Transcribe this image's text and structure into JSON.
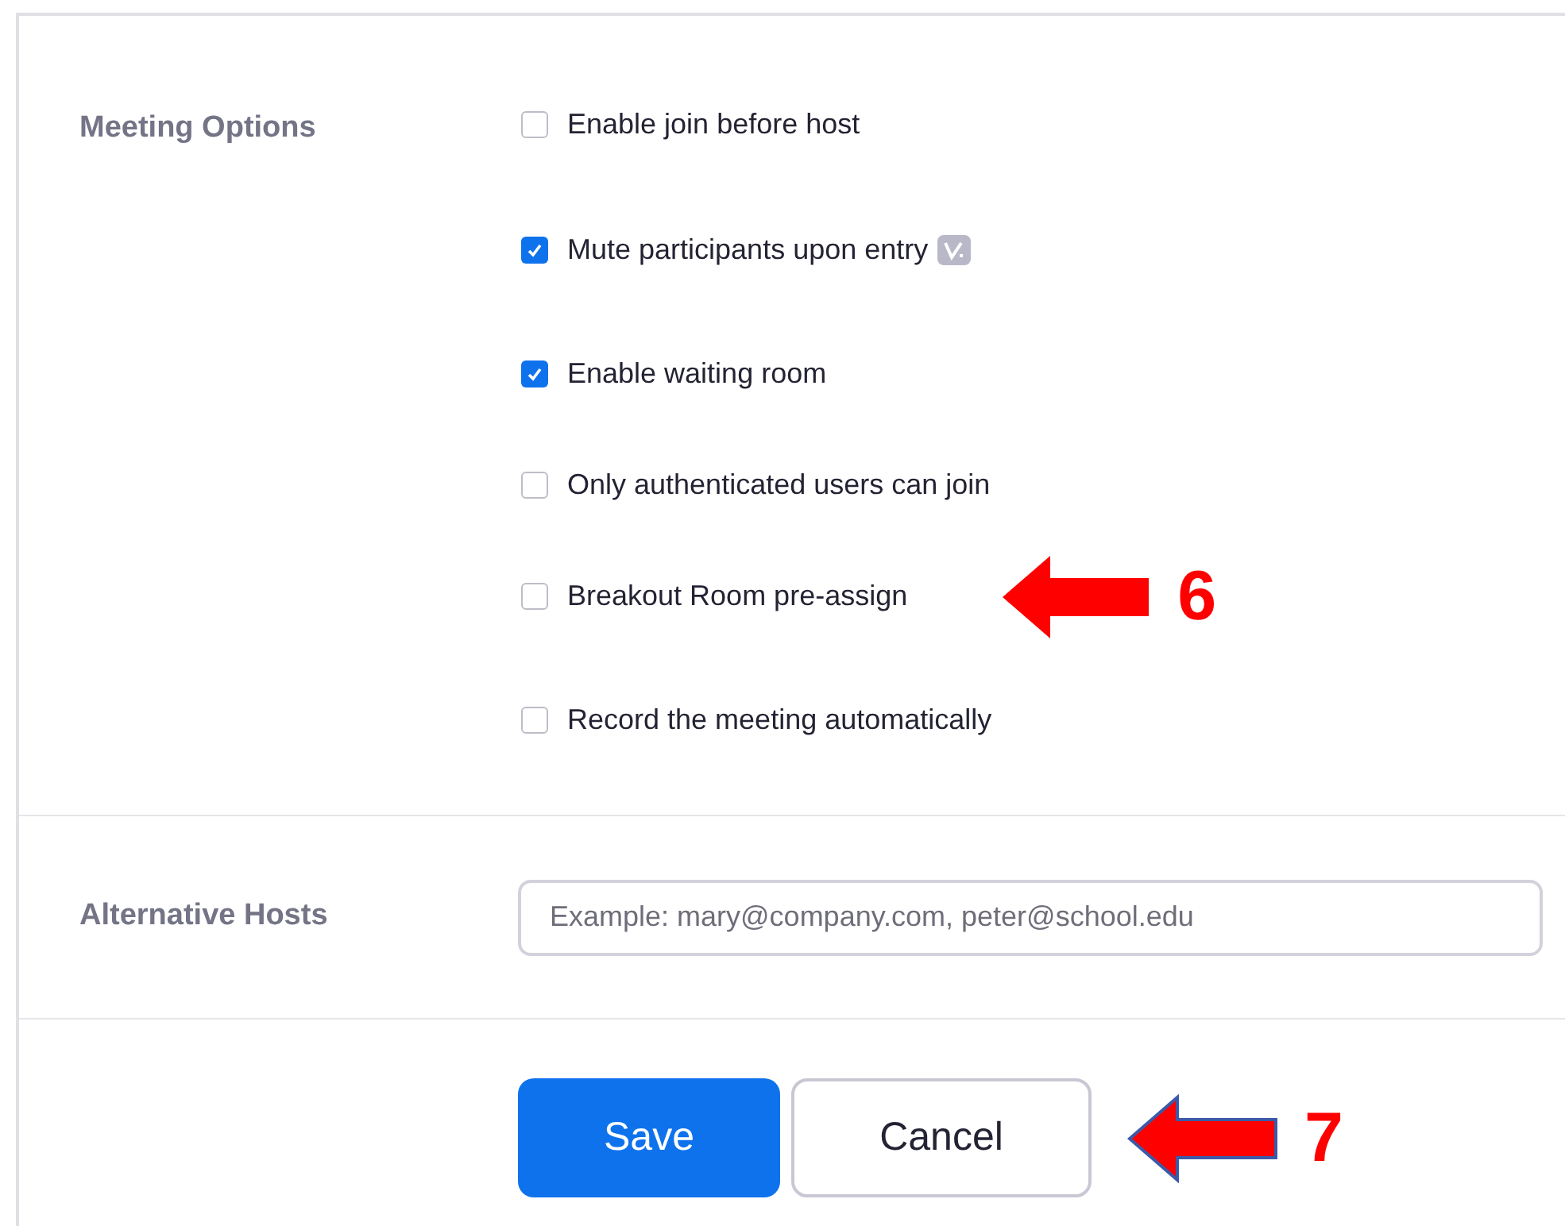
{
  "meeting_options": {
    "label": "Meeting Options",
    "options": [
      {
        "label": "Enable join before host",
        "checked": false
      },
      {
        "label": "Mute participants upon entry",
        "checked": true,
        "badge": true
      },
      {
        "label": "Enable waiting room",
        "checked": true
      },
      {
        "label": "Only authenticated users can join",
        "checked": false
      },
      {
        "label": "Breakout Room pre-assign",
        "checked": false,
        "annotation": {
          "number": "6",
          "outlined": false
        }
      },
      {
        "label": "Record the meeting automatically",
        "checked": false
      }
    ]
  },
  "alternative_hosts": {
    "label": "Alternative Hosts",
    "placeholder": "Example: mary@company.com, peter@school.edu"
  },
  "buttons": [
    {
      "label": "Save",
      "kind": "primary"
    },
    {
      "label": "Cancel",
      "kind": "secondary",
      "annotation": {
        "number": "7",
        "outlined": true
      }
    }
  ]
}
